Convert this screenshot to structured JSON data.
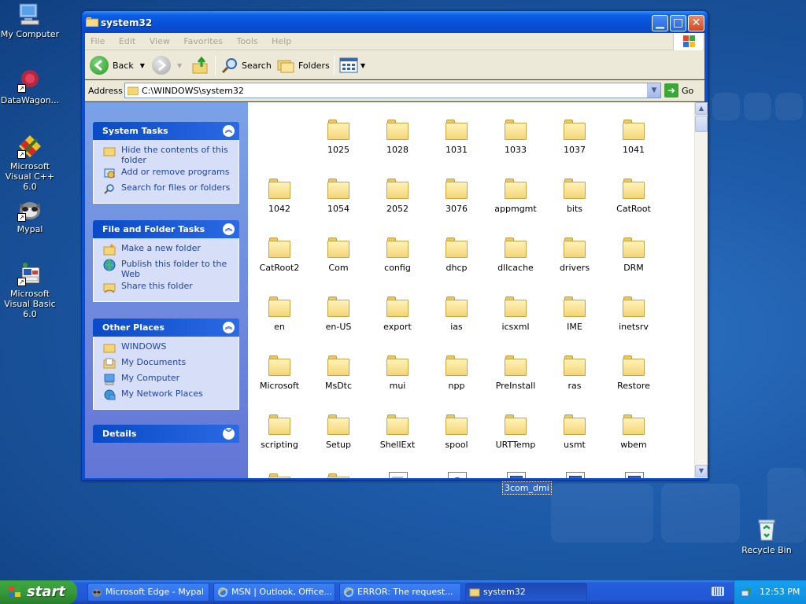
{
  "desktop": {
    "icons": [
      {
        "label": "My Computer"
      },
      {
        "label": "DataWagon..."
      },
      {
        "label": "Microsoft Visual C++ 6.0"
      },
      {
        "label": "Mypal"
      },
      {
        "label": "Microsoft Visual Basic 6.0"
      },
      {
        "label": "Recycle Bin"
      }
    ],
    "floating_selection_label": "3com_dmi"
  },
  "window": {
    "title": "system32",
    "menu": [
      "File",
      "Edit",
      "View",
      "Favorites",
      "Tools",
      "Help"
    ],
    "toolbar": {
      "back": "Back",
      "search": "Search",
      "folders": "Folders"
    },
    "address": {
      "label": "Address",
      "value": "C:\\WINDOWS\\system32",
      "go": "Go"
    },
    "taskpane": {
      "system_tasks": {
        "title": "System Tasks",
        "items": [
          "Hide the contents of this folder",
          "Add or remove programs",
          "Search for files or folders"
        ]
      },
      "file_folder_tasks": {
        "title": "File and Folder Tasks",
        "items": [
          "Make a new folder",
          "Publish this folder to the Web",
          "Share this folder"
        ]
      },
      "other_places": {
        "title": "Other Places",
        "items": [
          "WINDOWS",
          "My Documents",
          "My Computer",
          "My Network Places"
        ]
      },
      "details": {
        "title": "Details"
      }
    },
    "folders": [
      "1025",
      "1028",
      "1031",
      "1033",
      "1037",
      "1041",
      "1042",
      "1054",
      "2052",
      "3076",
      "appmgmt",
      "bits",
      "CatRoot",
      "CatRoot2",
      "Com",
      "config",
      "dhcp",
      "dllcache",
      "drivers",
      "DRM",
      "en",
      "en-US",
      "export",
      "ias",
      "icsxml",
      "IME",
      "inetsrv",
      "Microsoft",
      "MsDtc",
      "mui",
      "npp",
      "PreInstall",
      "ras",
      "Restore",
      "scripting",
      "Setup",
      "ShellExt",
      "spool",
      "URTTemp",
      "usmt",
      "wbem"
    ]
  },
  "taskbar": {
    "start": "start",
    "tasks": [
      {
        "label": "Microsoft Edge - Mypal"
      },
      {
        "label": "MSN | Outlook, Office..."
      },
      {
        "label": "ERROR: The request..."
      },
      {
        "label": "system32"
      }
    ],
    "clock": "12:53 PM"
  }
}
